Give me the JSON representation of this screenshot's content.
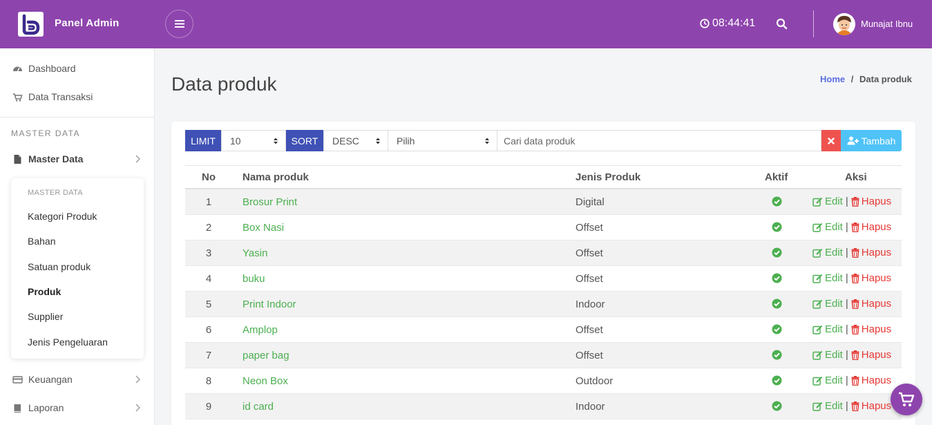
{
  "header": {
    "brand": "Panel Admin",
    "clock": "08:44:41",
    "username": "Munajat Ibnu"
  },
  "sidebar": {
    "items": [
      {
        "label": "Dashboard",
        "icon": "dashboard-icon"
      },
      {
        "label": "Data Transaksi",
        "icon": "cart-icon"
      }
    ],
    "section_title": "MASTER DATA",
    "master": {
      "label": "Master Data",
      "icon": "file-icon"
    },
    "submenu": {
      "title": "MASTER DATA",
      "items": [
        "Kategori Produk",
        "Bahan",
        "Satuan produk",
        "Produk",
        "Supplier",
        "Jenis Pengeluaran"
      ],
      "active": "Produk"
    },
    "bottom_items": [
      {
        "label": "Keuangan",
        "icon": "credit-card-icon"
      },
      {
        "label": "Laporan",
        "icon": "book-icon"
      }
    ]
  },
  "page": {
    "title": "Data produk",
    "breadcrumb_home": "Home",
    "breadcrumb_sep": "/",
    "breadcrumb_current": "Data produk"
  },
  "toolbar": {
    "limit_label": "LIMIT",
    "limit_value": "10",
    "sort_label": "SORT",
    "sort_value": "DESC",
    "filter_value": "Pilih",
    "search_placeholder": "Cari data produk",
    "add_label": "Tambah"
  },
  "table": {
    "headers": {
      "no": "No",
      "name": "Nama produk",
      "jenis": "Jenis Produk",
      "aktif": "Aktif",
      "aksi": "Aksi"
    },
    "edit_label": "Edit",
    "delete_label": "Hapus",
    "rows": [
      {
        "no": "1",
        "name": "Brosur Print",
        "jenis": "Digital"
      },
      {
        "no": "2",
        "name": "Box Nasi",
        "jenis": "Offset"
      },
      {
        "no": "3",
        "name": "Yasin",
        "jenis": "Offset"
      },
      {
        "no": "4",
        "name": "buku",
        "jenis": "Offset"
      },
      {
        "no": "5",
        "name": "Print Indoor",
        "jenis": "Indoor"
      },
      {
        "no": "6",
        "name": "Amplop",
        "jenis": "Offset"
      },
      {
        "no": "7",
        "name": "paper bag",
        "jenis": "Offset"
      },
      {
        "no": "8",
        "name": "Neon Box",
        "jenis": "Outdoor"
      },
      {
        "no": "9",
        "name": "id card",
        "jenis": "Indoor"
      }
    ]
  },
  "colors": {
    "header_bg": "#8e44ad",
    "label_bg": "#3f51b5",
    "link_green": "#4caf50",
    "delete_red": "#e53935",
    "add_blue": "#4fc3f7"
  }
}
